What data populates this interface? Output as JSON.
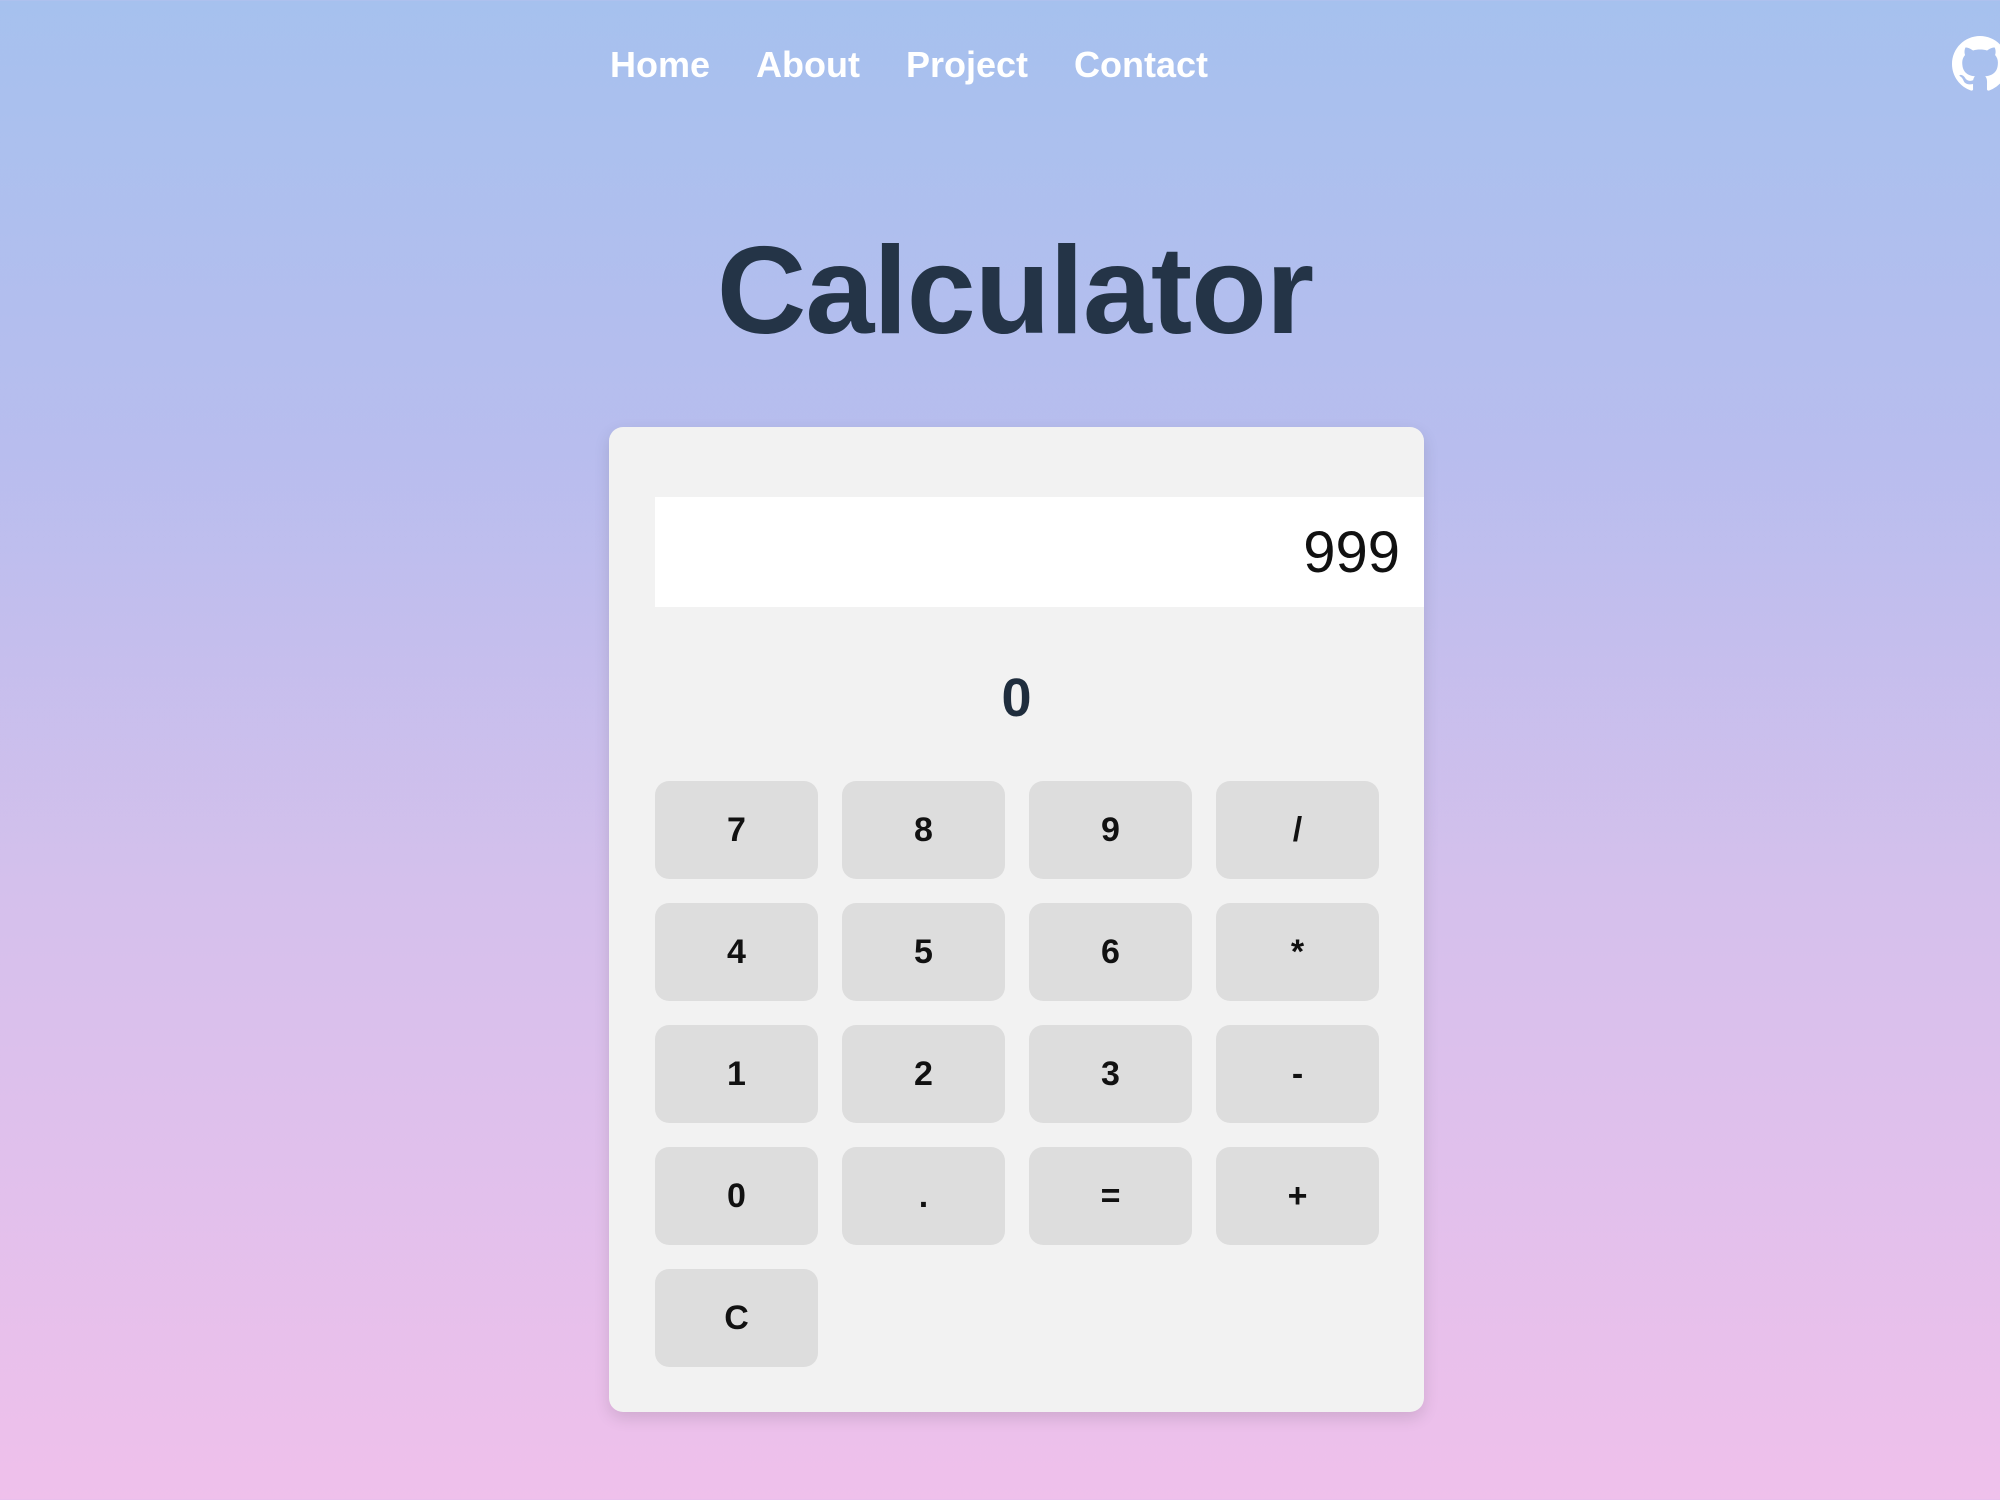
{
  "nav": {
    "items": [
      {
        "label": "Home"
      },
      {
        "label": "About"
      },
      {
        "label": "Project"
      },
      {
        "label": "Contact"
      }
    ]
  },
  "header_icon": "github-icon",
  "title": "Calculator",
  "calculator": {
    "input_value": "999",
    "result": "0",
    "keys": [
      {
        "label": "7",
        "name": "key-7-button"
      },
      {
        "label": "8",
        "name": "key-8-button"
      },
      {
        "label": "9",
        "name": "key-9-button"
      },
      {
        "label": "/",
        "name": "divide-button"
      },
      {
        "label": "4",
        "name": "key-4-button"
      },
      {
        "label": "5",
        "name": "key-5-button"
      },
      {
        "label": "6",
        "name": "key-6-button"
      },
      {
        "label": "*",
        "name": "multiply-button"
      },
      {
        "label": "1",
        "name": "key-1-button"
      },
      {
        "label": "2",
        "name": "key-2-button"
      },
      {
        "label": "3",
        "name": "key-3-button"
      },
      {
        "label": "-",
        "name": "subtract-button"
      },
      {
        "label": "0",
        "name": "key-0-button"
      },
      {
        "label": ".",
        "name": "decimal-button"
      },
      {
        "label": "=",
        "name": "equals-button"
      },
      {
        "label": "+",
        "name": "add-button"
      },
      {
        "label": "C",
        "name": "clear-button"
      }
    ]
  },
  "colors": {
    "title": "#243447",
    "panel": "#f2f2f2",
    "key": "#dddddd",
    "nav_text": "#ffffff"
  }
}
